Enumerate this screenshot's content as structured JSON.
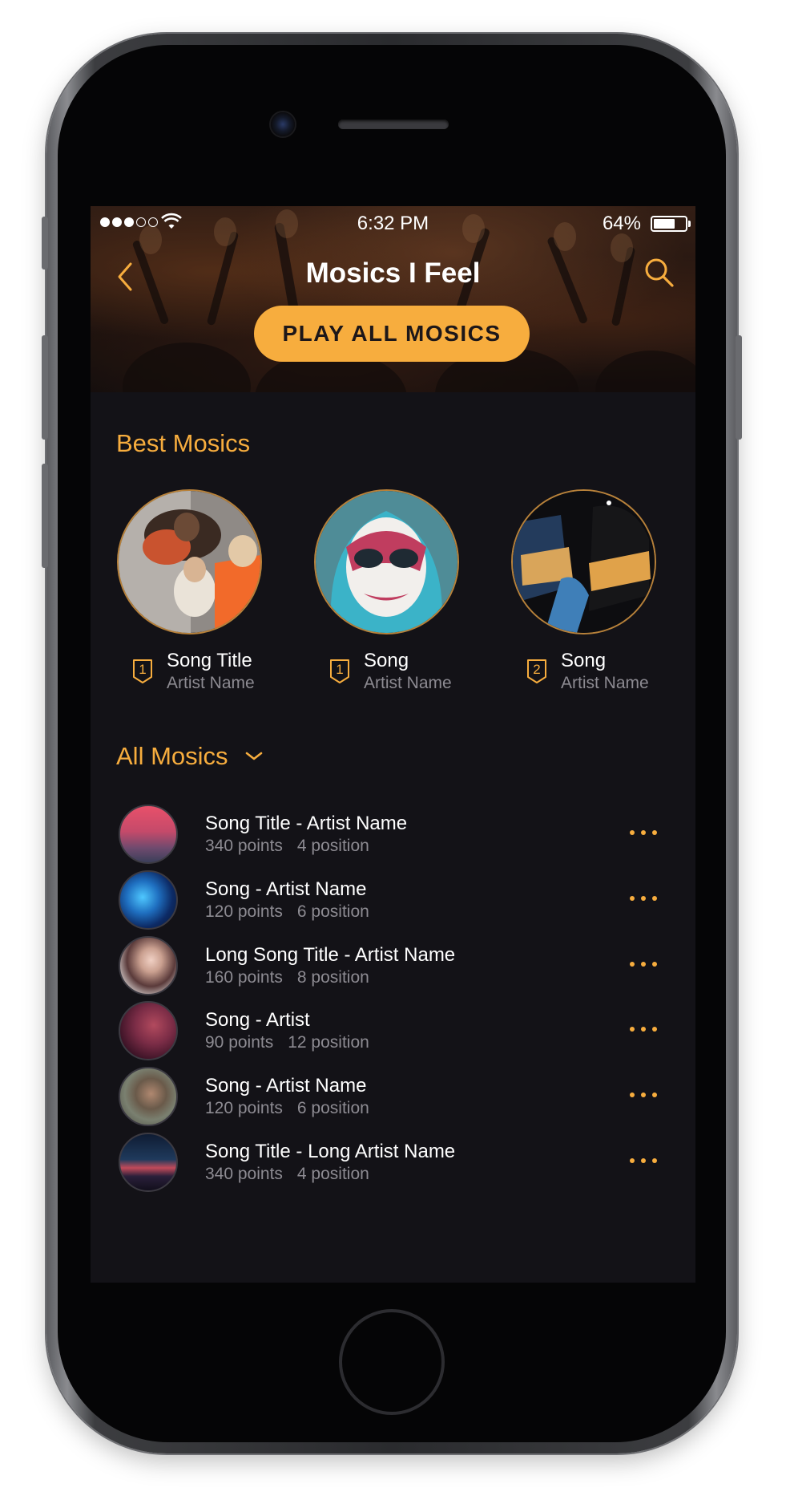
{
  "status_bar": {
    "time": "6:32 PM",
    "battery": "64%",
    "signal_bars_on": 3,
    "signal_bars_total": 5
  },
  "nav": {
    "title": "Mosics I Feel",
    "back_icon": "chevron-left-icon",
    "search_icon": "search-icon"
  },
  "play_all_label": "PLAY ALL MOSICS",
  "best_section": {
    "title": "Best Mosics",
    "items": [
      {
        "rank": "1",
        "song": "Song Title",
        "artist": "Artist Name"
      },
      {
        "rank": "1",
        "song": "Song",
        "artist": "Artist Name"
      },
      {
        "rank": "2",
        "song": "Song",
        "artist": "Artist Name"
      }
    ]
  },
  "all_section": {
    "title": "All Mosics",
    "toggle_icon": "chevron-down-icon",
    "items": [
      {
        "title": "Song Title - Artist Name",
        "points": "340 points",
        "position": "4 position"
      },
      {
        "title": "Song - Artist Name",
        "points": "120 points",
        "position": "6 position"
      },
      {
        "title": "Long Song Title - Artist Name",
        "points": "160 points",
        "position": "8 position"
      },
      {
        "title": "Song - Artist",
        "points": "90 points",
        "position": "12 position"
      },
      {
        "title": "Song - Artist Name",
        "points": "120 points",
        "position": "6 position"
      },
      {
        "title": "Song Title - Long Artist Name",
        "points": "340 points",
        "position": "4 position"
      }
    ]
  },
  "colors": {
    "accent": "#f7ad3e",
    "background": "#131217",
    "secondary_text": "#8d8b92"
  }
}
